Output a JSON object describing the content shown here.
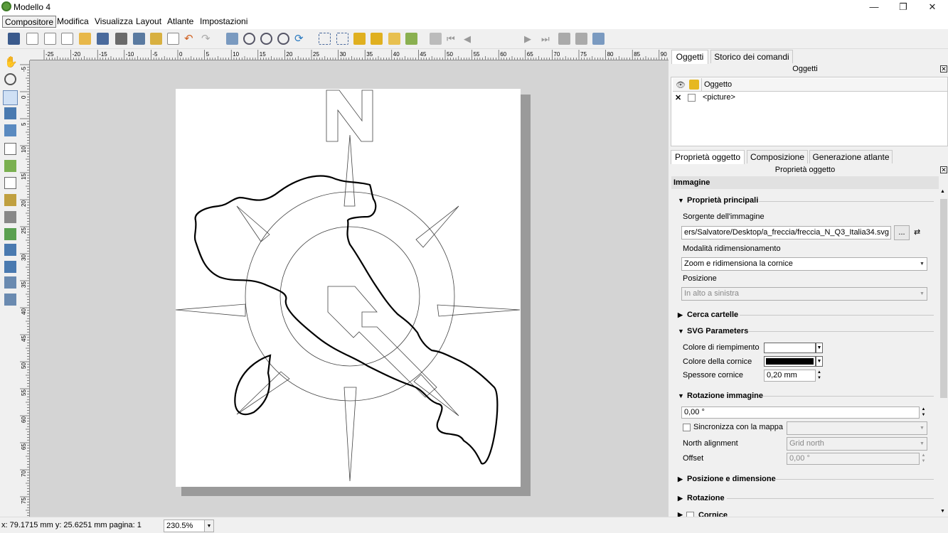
{
  "window": {
    "title": "Modello 4",
    "minimize": "—",
    "restore": "❐",
    "close": "✕"
  },
  "menu": [
    "Compositore",
    "Modifica",
    "Visualizza",
    "Layout",
    "Atlante",
    "Impostazioni"
  ],
  "toolbar": {
    "page_number": "1"
  },
  "ruler": {
    "h_labels": [
      "-25",
      "-20",
      "-15",
      "-10",
      "-5",
      "0",
      "5",
      "10",
      "15",
      "20",
      "25",
      "30",
      "35",
      "40",
      "45",
      "50",
      "55",
      "60",
      "65",
      "70",
      "75",
      "80",
      "85",
      "90"
    ],
    "v_labels": [
      "-5",
      "0",
      "5",
      "10",
      "15",
      "20",
      "25",
      "30",
      "35",
      "40",
      "45",
      "50",
      "55",
      "60",
      "65",
      "70",
      "75"
    ]
  },
  "panel_top": {
    "tabs": [
      "Oggetti",
      "Storico dei comandi"
    ],
    "title": "Oggetti",
    "column_header": "Oggetto",
    "rows": [
      {
        "name": "<picture>",
        "visible_mark": "✕"
      }
    ]
  },
  "panel_bottom": {
    "tabs": [
      "Proprietà oggetto",
      "Composizione",
      "Generazione atlante"
    ],
    "title": "Proprietà oggetto",
    "item_type": "Immagine",
    "main_props": {
      "header": "Proprietà principali",
      "source_label": "Sorgente dell'immagine",
      "source_value": "ers/Salvatore/Desktop/a_freccia/freccia_N_Q3_Italia34.svg",
      "browse_label": "...",
      "resize_label": "Modalità ridimensionamento",
      "resize_value": "Zoom e ridimensiona la cornice",
      "position_label": "Posizione",
      "position_value": "In alto a sinistra"
    },
    "search_dirs": "Cerca cartelle",
    "svg": {
      "header": "SVG Parameters",
      "fill_label": "Colore di riempimento",
      "fill_color": "#ffffff",
      "stroke_label": "Colore della cornice",
      "stroke_color": "#000000",
      "width_label": "Spessore cornice",
      "width_value": "0,20 mm"
    },
    "rotation": {
      "header": "Rotazione immagine",
      "value": "0,00 °",
      "sync_label": "Sincronizza con la mappa",
      "north_label": "North alignment",
      "north_value": "Grid north",
      "offset_label": "Offset",
      "offset_value": "0,00 °"
    },
    "pos_dim": "Posizione e dimensione",
    "rot2": "Rotazione",
    "frame": "Cornice"
  },
  "status": {
    "coords": "x: 79.1715 mm  y: 25.6251 mm  pagina: 1",
    "zoom": "230.5%"
  }
}
